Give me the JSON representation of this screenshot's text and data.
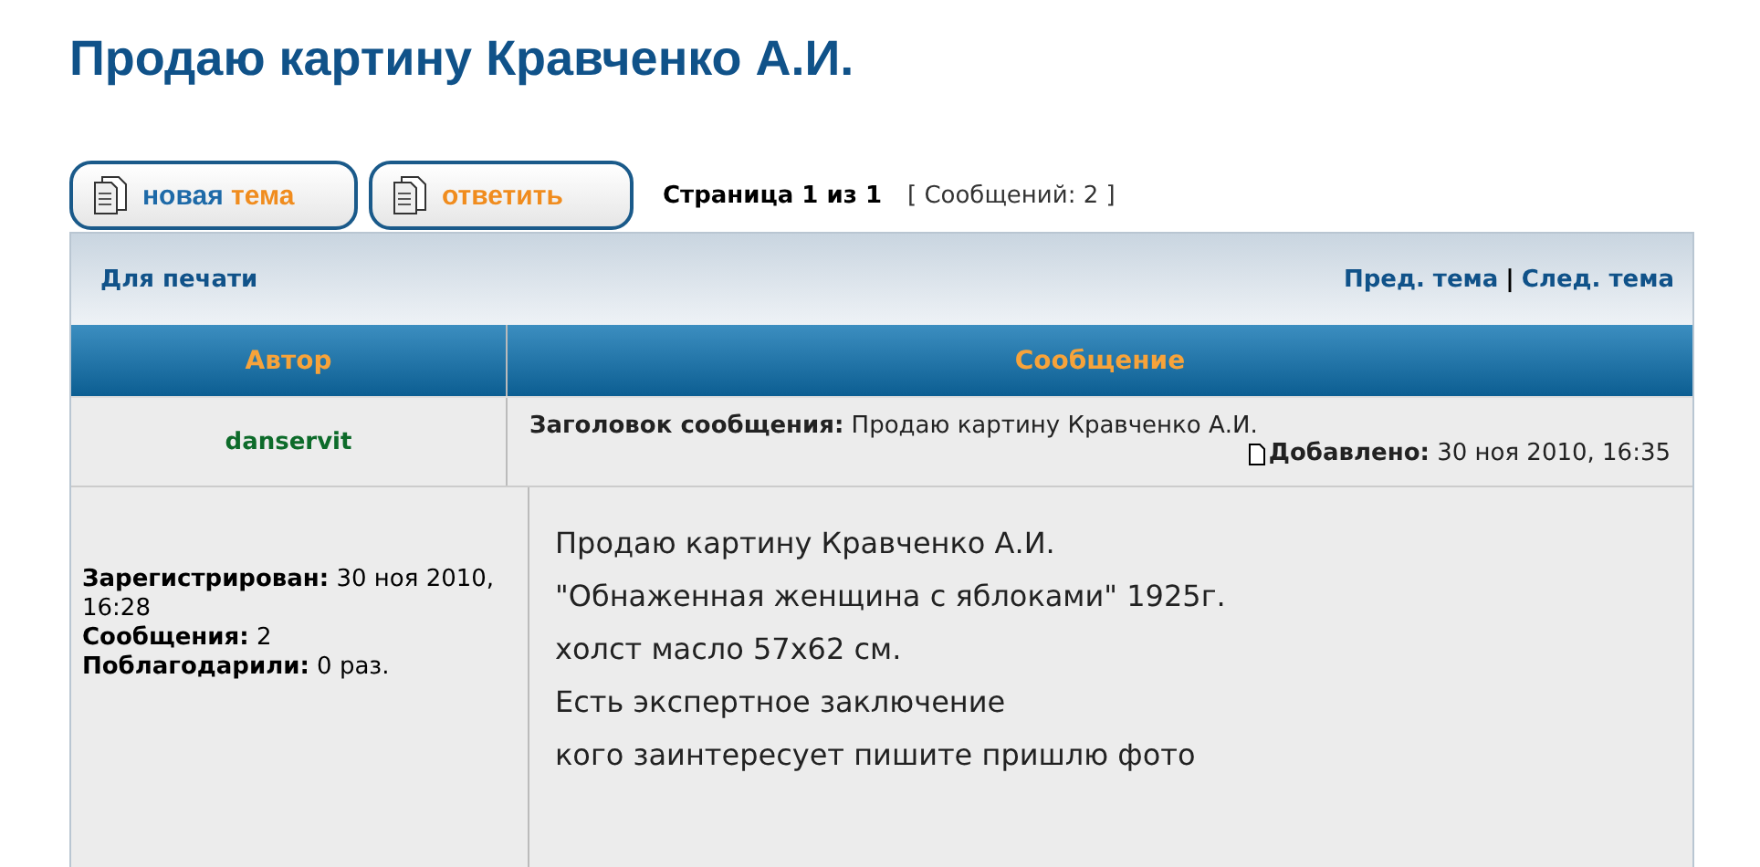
{
  "title": "Продаю картину Кравченко А.И.",
  "buttons": [
    {
      "parts": [
        {
          "text": "новая",
          "kind": "main"
        },
        {
          "text": "тема",
          "kind": "accent"
        }
      ]
    },
    {
      "parts": [
        {
          "text": "ответить",
          "kind": "accent"
        }
      ]
    }
  ],
  "pagination": "Страница 1 из 1",
  "post_count": "[ Сообщений: 2 ]",
  "toolbar": {
    "print": "Для печати",
    "prev": "Пред. тема",
    "separator": "|",
    "next": "След. тема"
  },
  "columns": [
    "Автор",
    "Сообщение"
  ],
  "post": {
    "author": "danservit",
    "subject": "**Заголовок сообщения:** Продаю картину Кравченко А.И.",
    "added": "**Добавлено:** 30 ноя 2010, 16:35",
    "profile": [
      "**Зарегистрирован:** 30 ноя 2010, 16:28",
      "**Сообщения:** 2",
      "**Поблагодарили:** 0 раз."
    ],
    "body": [
      "Продаю картину Кравченко А.И.",
      "\"Обнаженная женщина с яблоками\" 1925г.",
      "холст масло 57x62 см.",
      "Есть экспертное заключение",
      "кого заинтересует пишите пришлю фото"
    ]
  }
}
